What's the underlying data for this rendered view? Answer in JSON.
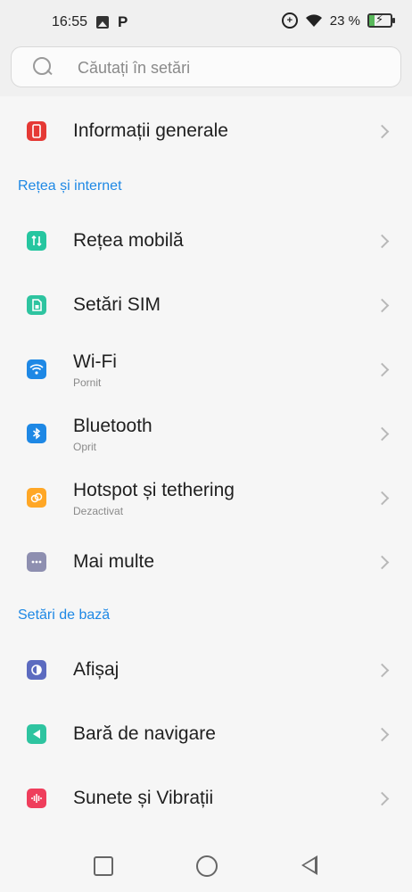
{
  "status": {
    "time": "16:55",
    "battery": "23 %"
  },
  "search": {
    "placeholder": "Căutați în setări"
  },
  "items": {
    "general": {
      "label": "Informații generale",
      "color": "#e53935"
    },
    "mobile": {
      "label": "Rețea mobilă",
      "color": "#26c6a0"
    },
    "sim": {
      "label": "Setări SIM",
      "color": "#2ec4a0"
    },
    "wifi": {
      "label": "Wi-Fi",
      "sub": "Pornit",
      "color": "#1e88e5"
    },
    "bluetooth": {
      "label": "Bluetooth",
      "sub": "Oprit",
      "color": "#1e88e5"
    },
    "hotspot": {
      "label": "Hotspot și tethering",
      "sub": "Dezactivat",
      "color": "#ffa726"
    },
    "more": {
      "label": "Mai multe",
      "color": "#8e8fb0"
    },
    "display": {
      "label": "Afișaj",
      "color": "#5c6bc0"
    },
    "navbar": {
      "label": "Bară de navigare",
      "color": "#2ec4a0"
    },
    "sounds": {
      "label": "Sunete și Vibrații",
      "color": "#ef3e5c"
    }
  },
  "sections": {
    "network": "Rețea și internet",
    "basic": "Setări de bază"
  }
}
